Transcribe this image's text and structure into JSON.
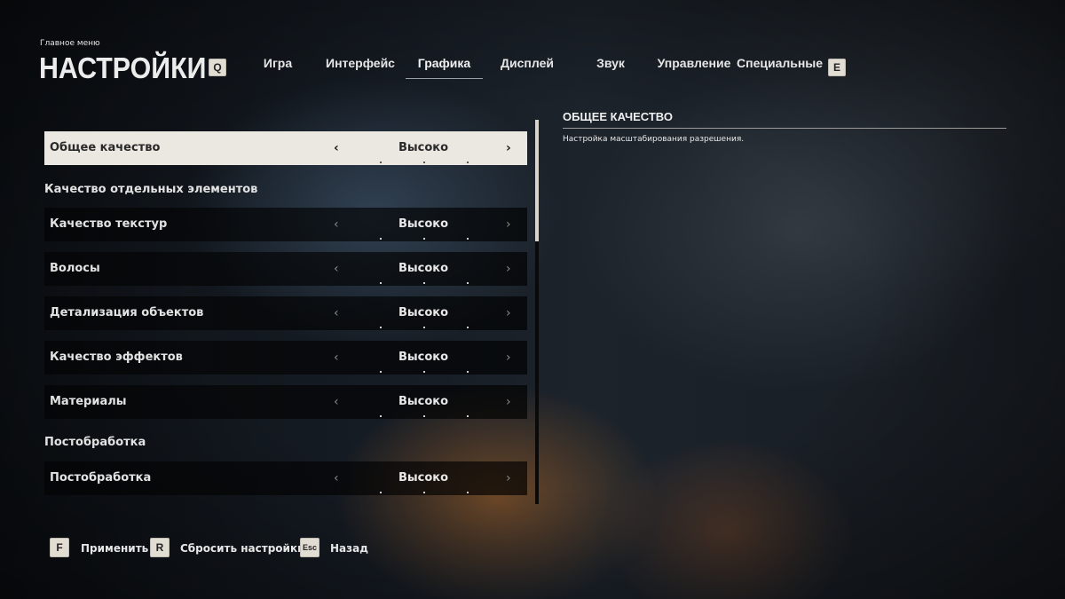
{
  "header": {
    "breadcrumb": "Главное меню",
    "title": "НАСТРОЙКИ",
    "prev_key": "Q",
    "next_key": "E",
    "tabs": [
      {
        "label": "Игра"
      },
      {
        "label": "Интерфейс"
      },
      {
        "label": "Графика",
        "active": true
      },
      {
        "label": "Дисплей"
      },
      {
        "label": "Звук"
      },
      {
        "label": "Управление"
      },
      {
        "label": "Специальные"
      }
    ]
  },
  "settings": {
    "overall": {
      "label": "Общее качество",
      "value": "Высоко",
      "selected": true
    },
    "section_elements": "Качество отдельных элементов",
    "texture": {
      "label": "Качество текстур",
      "value": "Высоко"
    },
    "hair": {
      "label": "Волосы",
      "value": "Высоко"
    },
    "detail": {
      "label": "Детализация объектов",
      "value": "Высоко"
    },
    "effects": {
      "label": "Качество эффектов",
      "value": "Высоко"
    },
    "materials": {
      "label": "Материалы",
      "value": "Высоко"
    },
    "section_post": "Постобработка",
    "postprocess": {
      "label": "Постобработка",
      "value": "Высоко"
    },
    "arrow_left": "‹",
    "arrow_right": "›"
  },
  "info": {
    "title": "ОБЩЕЕ КАЧЕСТВО",
    "description": "Настройка масштабирования разрешения."
  },
  "footer": {
    "apply_key": "F",
    "apply_label": "Применить",
    "reset_key": "R",
    "reset_label": "Сбросить настройки",
    "back_key": "Esc",
    "back_label": "Назад"
  },
  "colors": {
    "selected_row_bg": "#ebe7e1",
    "keycap_bg": "#e2ddd3",
    "text_primary": "#e8e8e8"
  }
}
